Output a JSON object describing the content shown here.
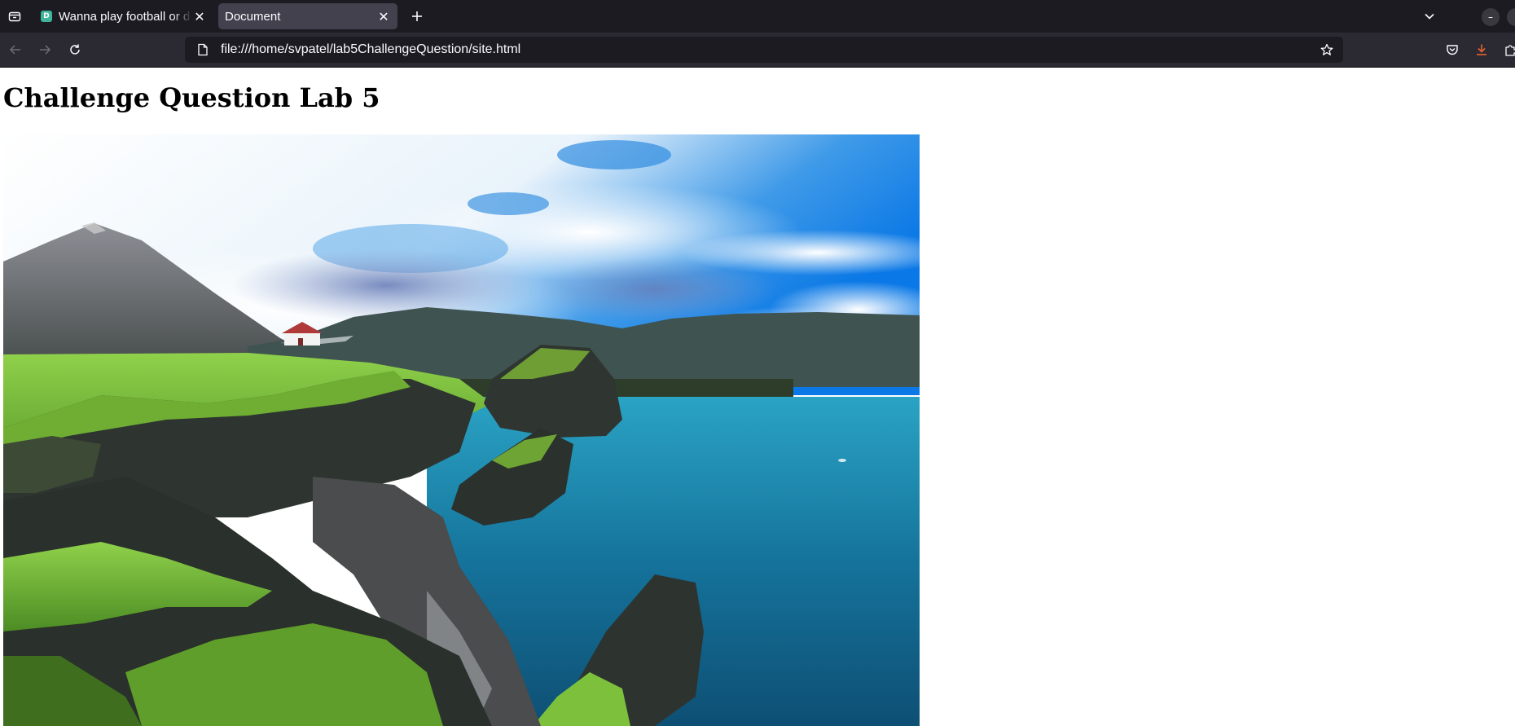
{
  "browser": {
    "tabs": [
      {
        "title": "Wanna play football or d",
        "favicon_letter": "D",
        "active": false
      },
      {
        "title": "Document",
        "active": true
      }
    ],
    "address_bar": {
      "url": "file:///home/svpatel/lab5ChallengeQuestion/site.html"
    },
    "icons": {
      "tab_list": "tab-list-icon",
      "new_tab": "plus-icon",
      "list_all_tabs": "chevron-down-icon",
      "back": "back-arrow-icon",
      "forward": "forward-arrow-icon",
      "reload": "reload-icon",
      "page": "page-icon",
      "bookmark": "star-icon",
      "pocket": "pocket-icon",
      "downloads": "download-icon",
      "extensions": "puzzle-icon"
    },
    "colors": {
      "tabstrip_bg": "#1c1b22",
      "active_tab_bg": "#42414d",
      "navbar_bg": "#2b2a33",
      "download_accent": "#e66133"
    }
  },
  "page": {
    "heading": "Challenge Question Lab 5",
    "image_subject": "coastal landscape"
  }
}
